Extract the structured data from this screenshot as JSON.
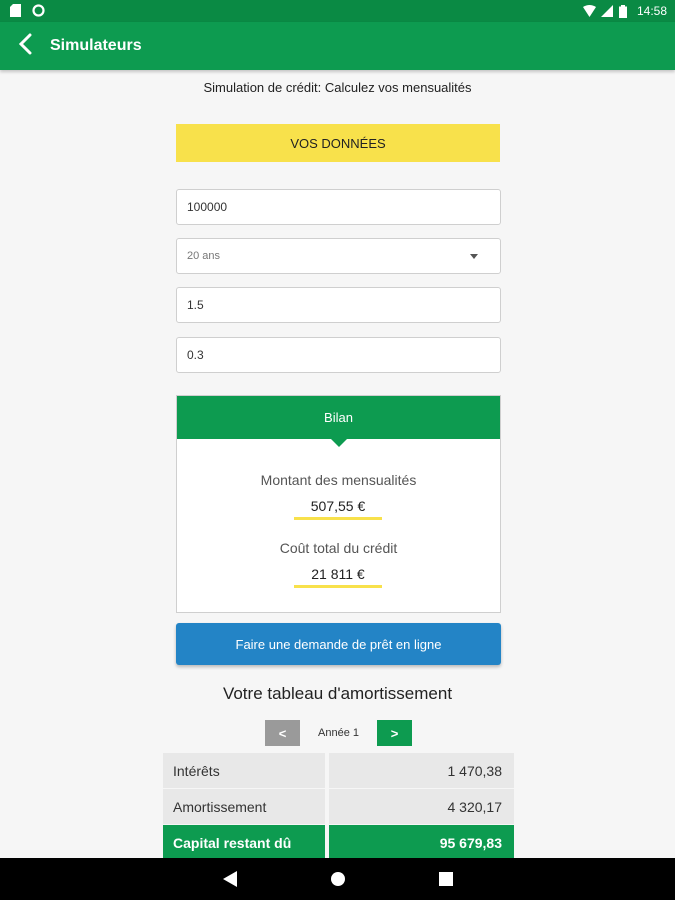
{
  "status_bar": {
    "time": "14:58"
  },
  "app_bar": {
    "title": "Simulateurs"
  },
  "subtitle": "Simulation de crédit: Calculez vos mensualités",
  "section_label": "VOS DONNÉES",
  "inputs": {
    "amount": "100000",
    "duration": "20 ans",
    "rate": "1.5",
    "insurance": "0.3"
  },
  "bilan": {
    "title": "Bilan",
    "monthly_label": "Montant des mensualités",
    "monthly_value": "507,55 €",
    "total_cost_label": "Coût total du crédit",
    "total_cost_value": "21 811 €"
  },
  "cta_label": "Faire une demande de prêt en ligne",
  "amortization": {
    "title": "Votre tableau d'amortissement",
    "prev_label": "<",
    "next_label": ">",
    "year_label": "Année 1",
    "rows": [
      {
        "label": "Intérêts",
        "value": "1 470,38"
      },
      {
        "label": "Amortissement",
        "value": "4 320,17"
      },
      {
        "label": "Capital restant dû",
        "value": "95 679,83"
      }
    ]
  },
  "colors": {
    "primary_green": "#0d9b50",
    "accent_yellow": "#f8e14b",
    "cta_blue": "#2384c6"
  }
}
